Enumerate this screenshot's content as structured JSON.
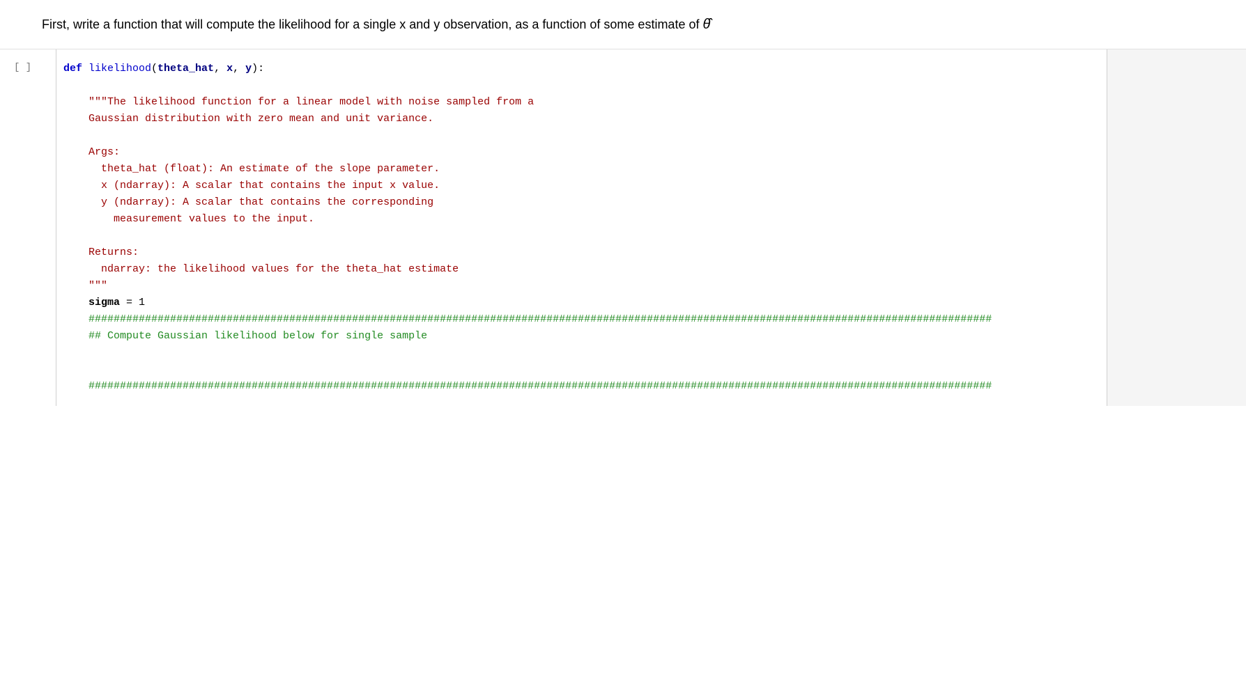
{
  "text_cell": {
    "content": "First, write a function that will compute the likelihood for a single x and y observation, as a function of some estimate of ",
    "theta_symbol": "θ̂"
  },
  "code_cell": {
    "execution_count": "[ ]",
    "lines": [
      {
        "id": "def_line",
        "parts": [
          {
            "type": "kw-def",
            "text": "def "
          },
          {
            "type": "fn-name",
            "text": "likelihood"
          },
          {
            "type": "punc",
            "text": "("
          },
          {
            "type": "param",
            "text": "theta_hat"
          },
          {
            "type": "punc",
            "text": ", "
          },
          {
            "type": "param",
            "text": "x"
          },
          {
            "type": "punc",
            "text": ", "
          },
          {
            "type": "param",
            "text": "y"
          },
          {
            "type": "punc",
            "text": "):"
          }
        ]
      },
      {
        "id": "blank1",
        "text": ""
      },
      {
        "id": "docstring_open",
        "indent": "    ",
        "parts": [
          {
            "type": "string-doc",
            "text": "\"\"\"The likelihood function for a linear model with noise sampled from a"
          }
        ]
      },
      {
        "id": "docstring_1",
        "indent": "    ",
        "parts": [
          {
            "type": "string-doc",
            "text": "    Gaussian distribution with zero mean and unit variance."
          }
        ]
      },
      {
        "id": "blank2",
        "text": ""
      },
      {
        "id": "docstring_args_header",
        "indent": "    ",
        "parts": [
          {
            "type": "string-doc",
            "text": "    Args:"
          }
        ]
      },
      {
        "id": "docstring_arg1",
        "indent": "    ",
        "parts": [
          {
            "type": "string-doc",
            "text": "      theta_hat (float): An estimate of the slope parameter."
          }
        ]
      },
      {
        "id": "docstring_arg2",
        "indent": "    ",
        "parts": [
          {
            "type": "string-doc",
            "text": "      x (ndarray): A scalar that contains the input x value."
          }
        ]
      },
      {
        "id": "docstring_arg3a",
        "indent": "    ",
        "parts": [
          {
            "type": "string-doc",
            "text": "      y (ndarray): A scalar that contains the corresponding"
          }
        ]
      },
      {
        "id": "docstring_arg3b",
        "indent": "    ",
        "parts": [
          {
            "type": "string-doc",
            "text": "        measurement values to the input."
          }
        ]
      },
      {
        "id": "blank3",
        "text": ""
      },
      {
        "id": "docstring_returns_header",
        "indent": "    ",
        "parts": [
          {
            "type": "string-doc",
            "text": "    Returns:"
          }
        ]
      },
      {
        "id": "docstring_returns_val",
        "indent": "    ",
        "parts": [
          {
            "type": "string-doc",
            "text": "      ndarray: the likelihood values for the theta_hat estimate"
          }
        ]
      },
      {
        "id": "docstring_close",
        "indent": "    ",
        "parts": [
          {
            "type": "string-doc",
            "text": "    \"\"\""
          }
        ]
      },
      {
        "id": "sigma_line",
        "indent": "    ",
        "parts": [
          {
            "type": "var-name",
            "text": "    sigma"
          },
          {
            "type": "punc",
            "text": " = "
          },
          {
            "type": "num",
            "text": "1"
          }
        ]
      },
      {
        "id": "comment_hashes1",
        "indent": "    ",
        "parts": [
          {
            "type": "comment",
            "text": "    ################################################################################################################################################"
          }
        ]
      },
      {
        "id": "comment_text",
        "indent": "    ",
        "parts": [
          {
            "type": "comment",
            "text": "    ## Compute Gaussian likelihood below for single sample"
          }
        ]
      },
      {
        "id": "blank4",
        "text": ""
      },
      {
        "id": "blank5",
        "text": ""
      },
      {
        "id": "comment_hashes2",
        "indent": "    ",
        "parts": [
          {
            "type": "comment",
            "text": "    ################################################################################################################################################"
          }
        ]
      }
    ]
  }
}
